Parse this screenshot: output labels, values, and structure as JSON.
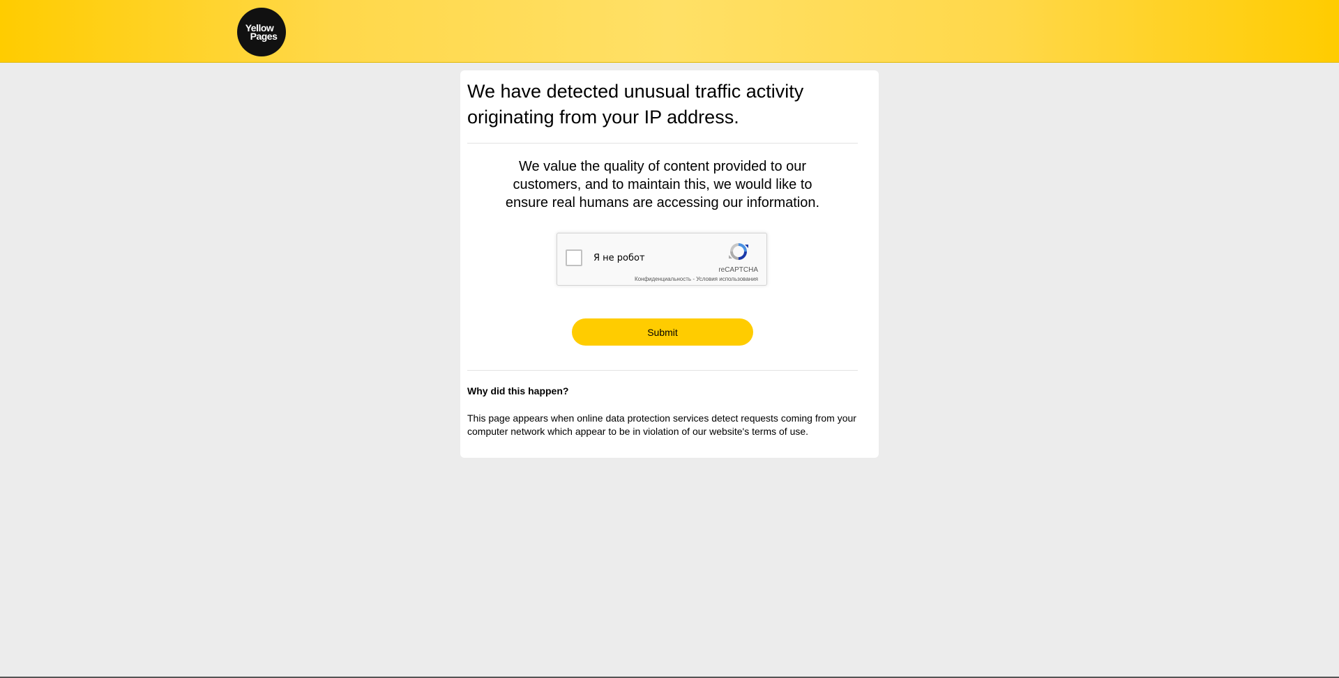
{
  "header": {
    "logo": {
      "line1": "Yellow",
      "line2": "Pages"
    }
  },
  "main": {
    "headline": "We have detected unusual traffic activity originating from your IP address.",
    "intro": "We value the quality of content provided to our customers, and to maintain this, we would like to ensure real humans are accessing our information.",
    "recaptcha": {
      "label": "Я не робот",
      "brand": "reCAPTCHA",
      "privacy_link": "Конфиденциальность",
      "separator": " - ",
      "terms_link": "Условия использования",
      "checked": false
    },
    "submit_label": "Submit",
    "why": {
      "title": "Why did this happen?",
      "text": "This page appears when online data protection services detect requests coming from your computer network which appear to be in violation of our website's terms of use."
    }
  },
  "colors": {
    "accent": "#ffcc00",
    "page_background": "#ececec",
    "card_background": "#ffffff"
  }
}
